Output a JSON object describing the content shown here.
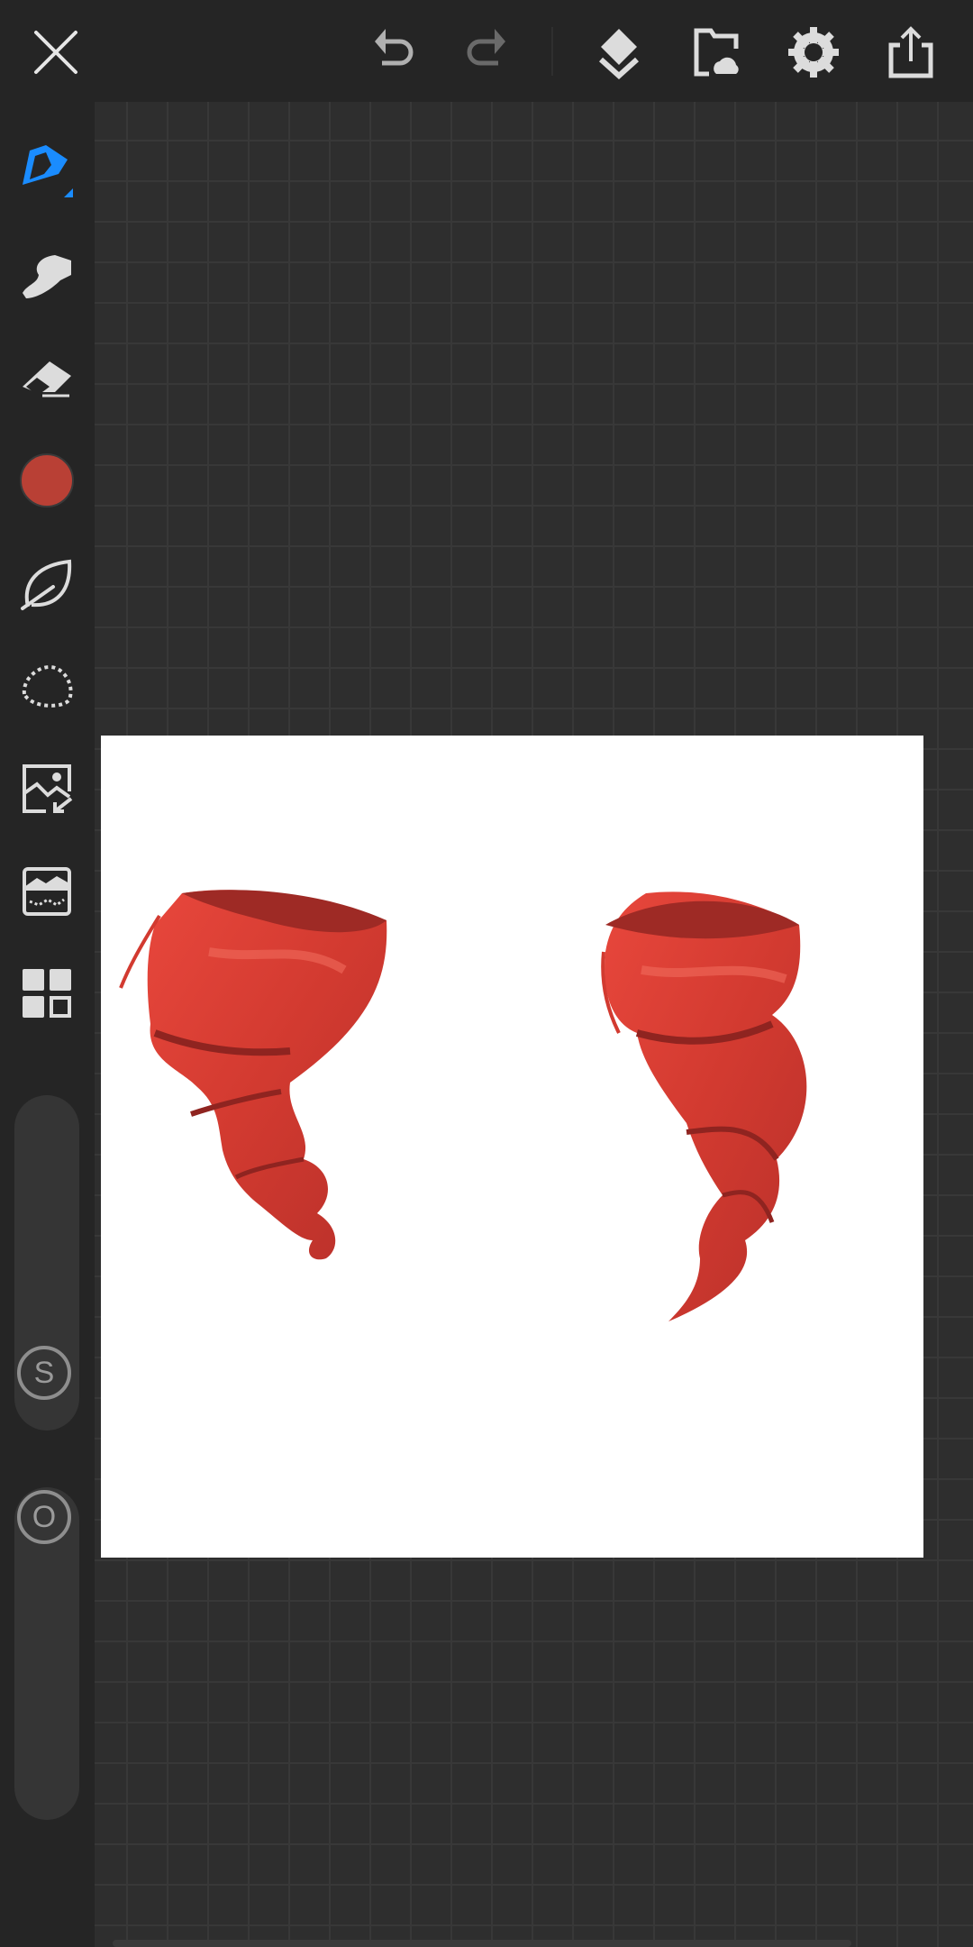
{
  "toolbar": {
    "close": "close-icon",
    "undo": "undo-icon",
    "redo": "redo-icon",
    "layers": "layers-icon",
    "gallery": "folder-cloud-icon",
    "settings": "gear-icon",
    "share": "share-icon"
  },
  "sidebar": {
    "tools": [
      "brush",
      "smudge",
      "eraser",
      "color",
      "liquify",
      "lasso-select",
      "import-image",
      "adjust-filter",
      "more-panels"
    ],
    "active_tool": "brush",
    "color": "#b94035",
    "accent": "#1a8cff",
    "size_label": "S",
    "opacity_label": "O"
  },
  "canvas": {
    "background": "#ffffff",
    "paint_color": "#c8372f"
  }
}
